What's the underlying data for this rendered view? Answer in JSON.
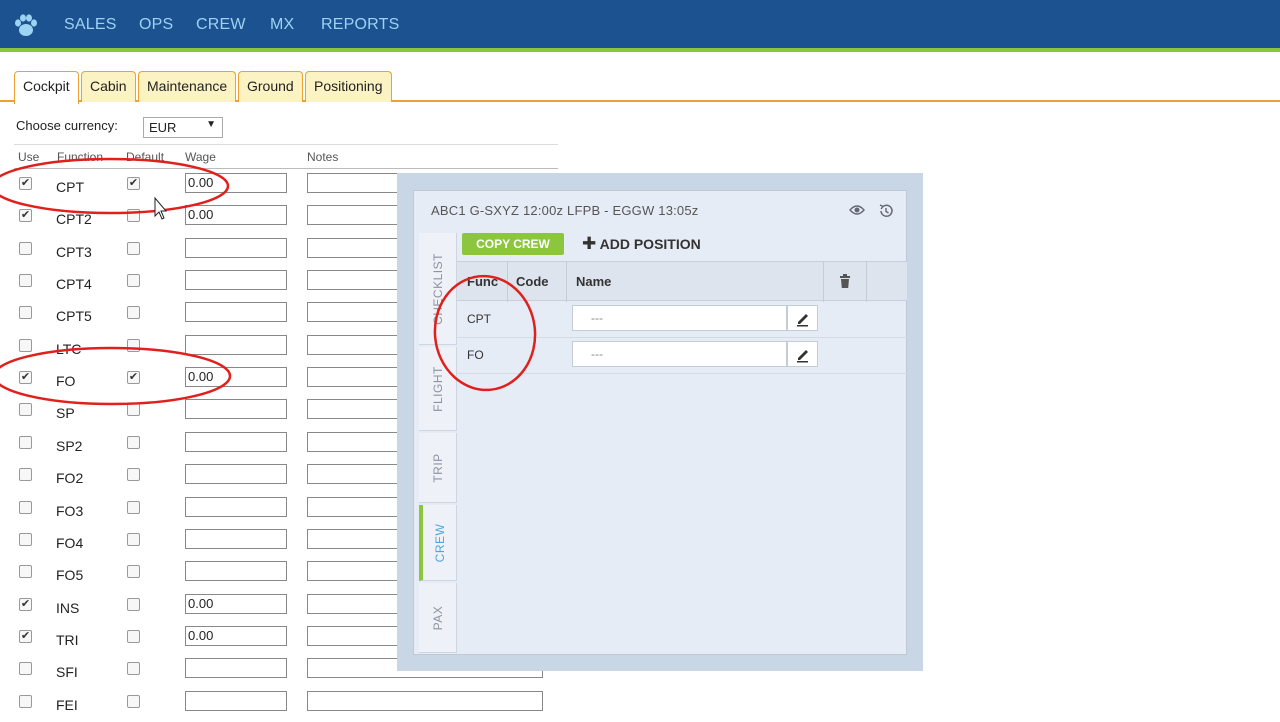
{
  "nav": {
    "logo_icon": "paw-icon",
    "items": [
      "SALES",
      "OPS",
      "CREW",
      "MX",
      "REPORTS"
    ]
  },
  "tabs": [
    "Cockpit",
    "Cabin",
    "Maintenance",
    "Ground",
    "Positioning"
  ],
  "active_tab": "Cockpit",
  "currency": {
    "label": "Choose currency:",
    "value": "EUR"
  },
  "table": {
    "headers": {
      "use": "Use",
      "function": "Function",
      "default": "Default",
      "wage": "Wage",
      "notes": "Notes"
    },
    "rows": [
      {
        "use": true,
        "function": "CPT",
        "default": true,
        "wage": "0.00"
      },
      {
        "use": true,
        "function": "CPT2",
        "default": false,
        "wage": "0.00"
      },
      {
        "use": false,
        "function": "CPT3",
        "default": false,
        "wage": ""
      },
      {
        "use": false,
        "function": "CPT4",
        "default": false,
        "wage": ""
      },
      {
        "use": false,
        "function": "CPT5",
        "default": false,
        "wage": ""
      },
      {
        "use": false,
        "function": "LTC",
        "default": false,
        "wage": ""
      },
      {
        "use": true,
        "function": "FO",
        "default": true,
        "wage": "0.00"
      },
      {
        "use": false,
        "function": "SP",
        "default": false,
        "wage": ""
      },
      {
        "use": false,
        "function": "SP2",
        "default": false,
        "wage": ""
      },
      {
        "use": false,
        "function": "FO2",
        "default": false,
        "wage": ""
      },
      {
        "use": false,
        "function": "FO3",
        "default": false,
        "wage": ""
      },
      {
        "use": false,
        "function": "FO4",
        "default": false,
        "wage": ""
      },
      {
        "use": false,
        "function": "FO5",
        "default": false,
        "wage": ""
      },
      {
        "use": true,
        "function": "INS",
        "default": false,
        "wage": "0.00"
      },
      {
        "use": true,
        "function": "TRI",
        "default": false,
        "wage": "0.00"
      },
      {
        "use": false,
        "function": "SFI",
        "default": false,
        "wage": ""
      },
      {
        "use": false,
        "function": "FEI",
        "default": false,
        "wage": ""
      }
    ]
  },
  "panel": {
    "title": "ABC1 G-SXYZ 12:00z LFPB - EGGW 13:05z",
    "header_icons": [
      "eye-icon",
      "history-icon"
    ],
    "side_tabs": [
      "CHECKLIST",
      "FLIGHT",
      "TRIP",
      "CREW",
      "PAX"
    ],
    "active_side_tab": "CREW",
    "copy_crew": "COPY CREW",
    "add_position": "ADD POSITION",
    "columns": {
      "func": "Func",
      "code": "Code",
      "name": "Name"
    },
    "crew_rows": [
      {
        "func": "CPT",
        "name": "---"
      },
      {
        "func": "FO",
        "name": "---"
      }
    ]
  },
  "colors": {
    "nav_bg": "#1d5290",
    "nav_text": "#9cd3f2",
    "accent_green": "#8cc63f",
    "tab_orange": "#f0a030",
    "annotation_red": "#e0201c"
  }
}
